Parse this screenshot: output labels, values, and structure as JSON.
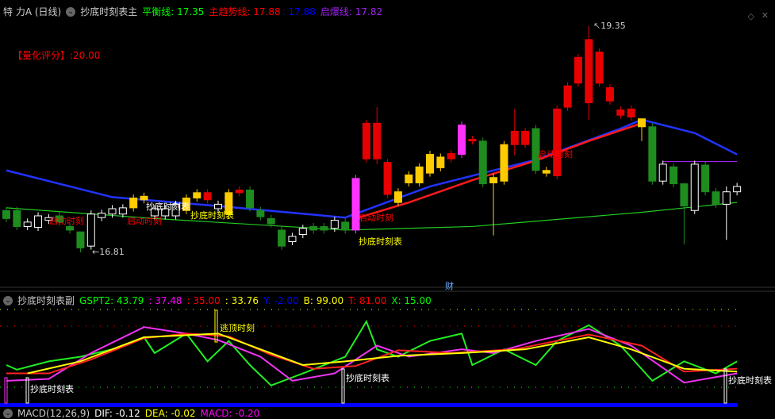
{
  "header": {
    "stock": "特 力A (日线)",
    "indicator": "抄底时刻表主",
    "balance_label": "平衡线: 17.35",
    "trend_label": "主趋势线: 17.88",
    "trend2": ": 17.88",
    "burst_label": "启爆线: 17.82"
  },
  "score": "【量化评分】:20.00",
  "price_marks": {
    "high": "19.35",
    "low": "16.81"
  },
  "annotations": {
    "bottom": "抄底时刻表",
    "start": "启动时刻",
    "escape": "逃顶时刻"
  },
  "axis_label": "财",
  "sub_header": {
    "name": "抄底时刻表副",
    "gspt2": "GSPT2: 43.79",
    "v2": ": 37.48",
    "v3": ": 35.00",
    "v4": ": 33.76",
    "y": "Y: -2.00",
    "b": "B: 99.00",
    "t": "T: 81.00",
    "x": "X: 15.00"
  },
  "macd_header": {
    "name": "MACD(12,26,9)",
    "dif": "DIF: -0.12",
    "dea": "DEA: -0.02",
    "macd": "MACD: -0.20"
  },
  "colors": {
    "g": "#1e8c1e",
    "r": "#e60000",
    "y": "#ffcc00",
    "m": "#ff33ff",
    "w": "#ffffff"
  },
  "candles": [
    [
      17.28,
      17.19,
      "g"
    ],
    [
      17.28,
      17.1,
      "g"
    ],
    [
      17.15,
      17.1,
      "w"
    ],
    [
      17.09,
      17.22,
      "w"
    ],
    [
      17.17,
      17.2,
      "w"
    ],
    [
      17.22,
      17.15,
      "g"
    ],
    [
      17.1,
      17.06,
      "g"
    ],
    [
      17.04,
      16.86,
      "g",
      17.04,
      16.81
    ],
    [
      16.88,
      17.24,
      "w"
    ],
    [
      17.2,
      17.25,
      "w"
    ],
    [
      17.24,
      17.3,
      "w"
    ],
    [
      17.24,
      17.31,
      "w"
    ],
    [
      17.31,
      17.42,
      "y"
    ],
    [
      17.4,
      17.44,
      "y"
    ],
    [
      17.22,
      17.3,
      "w"
    ],
    [
      17.22,
      17.3,
      "w"
    ],
    [
      17.22,
      17.35,
      "w"
    ],
    [
      17.28,
      17.42,
      "y"
    ],
    [
      17.42,
      17.48,
      "y"
    ],
    [
      17.4,
      17.48,
      "r"
    ],
    [
      17.3,
      17.35,
      "w"
    ],
    [
      17.24,
      17.48,
      "y"
    ],
    [
      17.48,
      17.51,
      "r"
    ],
    [
      17.51,
      17.31,
      "g"
    ],
    [
      17.28,
      17.21,
      "g"
    ],
    [
      17.19,
      17.13,
      "g"
    ],
    [
      17.06,
      16.88,
      "g"
    ],
    [
      16.93,
      16.99,
      "w"
    ],
    [
      17.01,
      17.08,
      "w"
    ],
    [
      17.1,
      17.06,
      "g"
    ],
    [
      17.1,
      17.06,
      "g"
    ],
    [
      17.08,
      17.17,
      "w"
    ],
    [
      17.15,
      17.06,
      "g"
    ],
    [
      17.06,
      17.64,
      "m"
    ],
    [
      17.86,
      18.26,
      "r"
    ],
    [
      17.86,
      18.26,
      "r",
      18.44,
      17.8
    ],
    [
      17.46,
      17.82,
      "r"
    ],
    [
      17.37,
      17.49,
      "y"
    ],
    [
      17.59,
      17.68,
      "y"
    ],
    [
      17.59,
      17.77,
      "y"
    ],
    [
      17.7,
      17.91,
      "y"
    ],
    [
      17.76,
      17.88,
      "y"
    ],
    [
      17.86,
      17.92,
      "r"
    ],
    [
      17.91,
      18.24,
      "m"
    ],
    [
      18.06,
      18.08,
      "r"
    ],
    [
      18.06,
      17.58,
      "g"
    ],
    [
      17.59,
      17.65,
      "y",
      17.7,
      17.0
    ],
    [
      17.61,
      18.02,
      "y"
    ],
    [
      18.02,
      18.17,
      "r",
      18.42,
      17.9
    ],
    [
      18.02,
      18.17,
      "r"
    ],
    [
      18.2,
      17.73,
      "g"
    ],
    [
      17.73,
      17.7,
      "y"
    ],
    [
      17.67,
      18.42,
      "r"
    ],
    [
      18.44,
      18.68,
      "r"
    ],
    [
      18.71,
      19.0,
      "r"
    ],
    [
      18.49,
      19.2,
      "r",
      19.35,
      18.3
    ],
    [
      18.71,
      19.06,
      "r"
    ],
    [
      18.51,
      18.66,
      "r"
    ],
    [
      18.35,
      18.41,
      "r"
    ],
    [
      18.33,
      18.42,
      "r"
    ],
    [
      18.22,
      18.31,
      "y",
      18.31,
      18.06
    ],
    [
      18.22,
      17.61,
      "g"
    ],
    [
      17.61,
      17.8,
      "w"
    ],
    [
      17.77,
      17.58,
      "g"
    ],
    [
      17.58,
      17.33,
      "g",
      17.58,
      16.9
    ],
    [
      17.28,
      17.8,
      "w"
    ],
    [
      17.79,
      17.49,
      "g"
    ],
    [
      17.49,
      17.35,
      "g"
    ],
    [
      17.35,
      17.49,
      "w",
      17.55,
      16.95
    ],
    [
      17.49,
      17.55,
      "w"
    ]
  ],
  "lines": {
    "blue": [
      [
        0,
        17.73
      ],
      [
        5,
        17.58
      ],
      [
        10,
        17.43
      ],
      [
        20,
        17.33
      ],
      [
        32,
        17.2
      ],
      [
        40,
        17.55
      ],
      [
        50,
        17.85
      ],
      [
        58,
        18.2
      ],
      [
        60,
        18.3
      ],
      [
        65,
        18.15
      ],
      [
        69,
        17.91
      ]
    ],
    "red": [
      [
        33,
        17.19
      ],
      [
        38,
        17.37
      ],
      [
        44,
        17.62
      ],
      [
        50,
        17.84
      ],
      [
        55,
        18.06
      ],
      [
        60,
        18.26
      ]
    ],
    "green": [
      [
        0,
        17.31
      ],
      [
        14,
        17.19
      ],
      [
        32,
        17.06
      ],
      [
        44,
        17.1
      ],
      [
        60,
        17.26
      ],
      [
        69,
        17.37
      ]
    ],
    "purple": [
      [
        62,
        17.83
      ],
      [
        69,
        17.83
      ]
    ]
  },
  "sub": {
    "green": [
      [
        0,
        39
      ],
      [
        1,
        34
      ],
      [
        4,
        43
      ],
      [
        7,
        48
      ],
      [
        10,
        56
      ],
      [
        13,
        69
      ],
      [
        14,
        52
      ],
      [
        17,
        73
      ],
      [
        19,
        43
      ],
      [
        21,
        65
      ],
      [
        23,
        39
      ],
      [
        25,
        17
      ],
      [
        28,
        30
      ],
      [
        30,
        39
      ],
      [
        32,
        48
      ],
      [
        34,
        86
      ],
      [
        35,
        56
      ],
      [
        37,
        48
      ],
      [
        40,
        65
      ],
      [
        43,
        73
      ],
      [
        44,
        39
      ],
      [
        47,
        56
      ],
      [
        50,
        39
      ],
      [
        52,
        65
      ],
      [
        55,
        82
      ],
      [
        58,
        60
      ],
      [
        61,
        22
      ],
      [
        64,
        43
      ],
      [
        67,
        30
      ],
      [
        69,
        43
      ]
    ],
    "magenta": [
      [
        0,
        22
      ],
      [
        4,
        24
      ],
      [
        8,
        52
      ],
      [
        13,
        80
      ],
      [
        17,
        73
      ],
      [
        20,
        66
      ],
      [
        24,
        48
      ],
      [
        27,
        22
      ],
      [
        31,
        30
      ],
      [
        35,
        60
      ],
      [
        38,
        48
      ],
      [
        43,
        56
      ],
      [
        46,
        52
      ],
      [
        50,
        65
      ],
      [
        55,
        78
      ],
      [
        59,
        60
      ],
      [
        64,
        20
      ],
      [
        69,
        30
      ]
    ],
    "red": [
      [
        0,
        30
      ],
      [
        4,
        30
      ],
      [
        8,
        45
      ],
      [
        13,
        68
      ],
      [
        17,
        73
      ],
      [
        21,
        70
      ],
      [
        25,
        50
      ],
      [
        29,
        35
      ],
      [
        33,
        38
      ],
      [
        37,
        55
      ],
      [
        42,
        52
      ],
      [
        48,
        56
      ],
      [
        55,
        72
      ],
      [
        60,
        60
      ],
      [
        64,
        32
      ],
      [
        69,
        35
      ]
    ],
    "yellow": [
      [
        2,
        30
      ],
      [
        7,
        43
      ],
      [
        13,
        69
      ],
      [
        20,
        73
      ],
      [
        24,
        56
      ],
      [
        28,
        39
      ],
      [
        32,
        43
      ],
      [
        37,
        49
      ],
      [
        43,
        52
      ],
      [
        49,
        56
      ],
      [
        55,
        69
      ],
      [
        59,
        56
      ],
      [
        64,
        35
      ],
      [
        69,
        32
      ]
    ]
  }
}
